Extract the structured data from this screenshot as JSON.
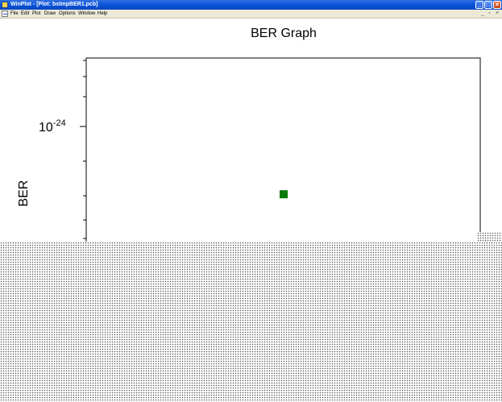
{
  "window": {
    "title": "WinPlot - [Plot: bstmpBER1.pcb]",
    "min_glyph": "_",
    "max_glyph": "□",
    "close_glyph": "×"
  },
  "menu": {
    "items": [
      "File",
      "Edit",
      "Plot",
      "Draw",
      "Options",
      "Window",
      "Help"
    ],
    "mdi_min": "_",
    "mdi_restore": "▫",
    "mdi_close": "×"
  },
  "colors": {
    "titlebar": "#0a53d8",
    "point": "#0a7a0a",
    "axis": "#000000"
  },
  "chart_data": {
    "type": "scatter",
    "title": "BER Graph",
    "ylabel": "BER",
    "yscale": "log",
    "y_tick_labels": [
      {
        "base": "10",
        "exp": "-24"
      }
    ],
    "series": [
      {
        "points": [
          {
            "y": 3.2e-25
          }
        ]
      }
    ],
    "grid": false
  }
}
